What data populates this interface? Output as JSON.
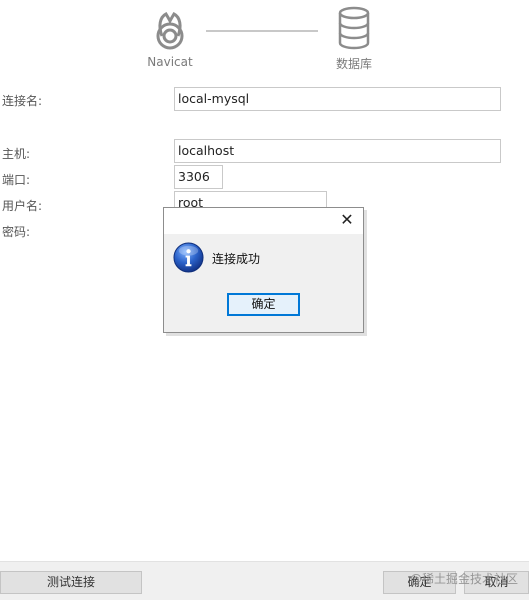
{
  "header": {
    "navicat_label": "Navicat",
    "database_label": "数据库"
  },
  "form": {
    "connection_name": {
      "label": "连接名:",
      "value": "local-mysql"
    },
    "host": {
      "label": "主机:",
      "value": "localhost"
    },
    "port": {
      "label": "端口:",
      "value": "3306"
    },
    "username": {
      "label": "用户名:",
      "value": "root"
    },
    "password": {
      "label": "密码:"
    }
  },
  "footer": {
    "test_label": "测试连接",
    "ok_label": "确定",
    "cancel_label": "取消",
    "watermark": "@稀土掘金技术社区"
  },
  "dialog": {
    "message": "连接成功",
    "ok_label": "确定",
    "close_symbol": "✕"
  },
  "colors": {
    "accent": "#0078d7",
    "info_icon": "#1f55b8"
  }
}
